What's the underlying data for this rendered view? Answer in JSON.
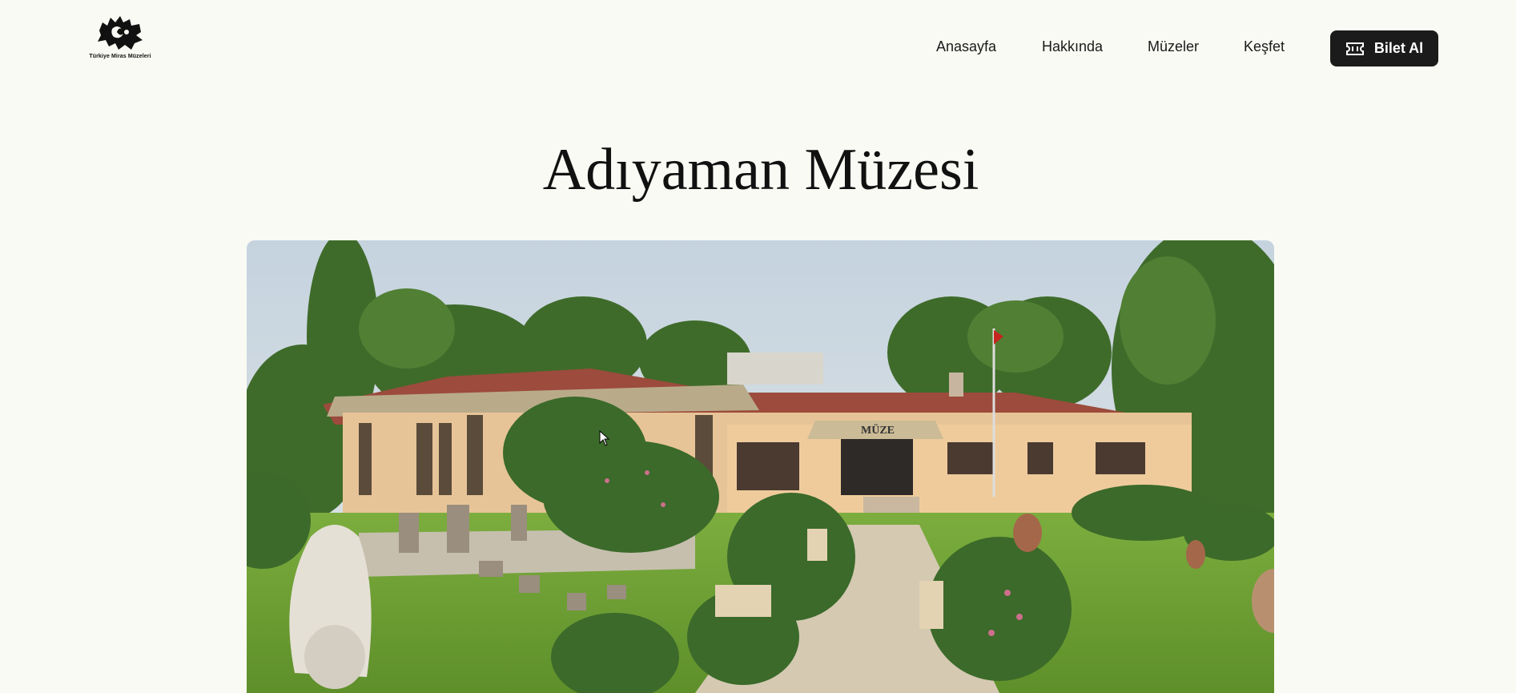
{
  "logo": {
    "text": "Türkiye Miras Müzeleri"
  },
  "nav": {
    "items": [
      "Anasayfa",
      "Hakkında",
      "Müzeler",
      "Keşfet"
    ],
    "ticket_button": "Bilet Al",
    "ticket_icon": "ticket-icon"
  },
  "page": {
    "title": "Adıyaman Müzesi"
  },
  "hero": {
    "sign_text": "MÜZE",
    "icon": "museum-photo"
  },
  "colors": {
    "background": "#f9faf3",
    "button_bg": "#1b1b1b",
    "button_text": "#ffffff"
  }
}
